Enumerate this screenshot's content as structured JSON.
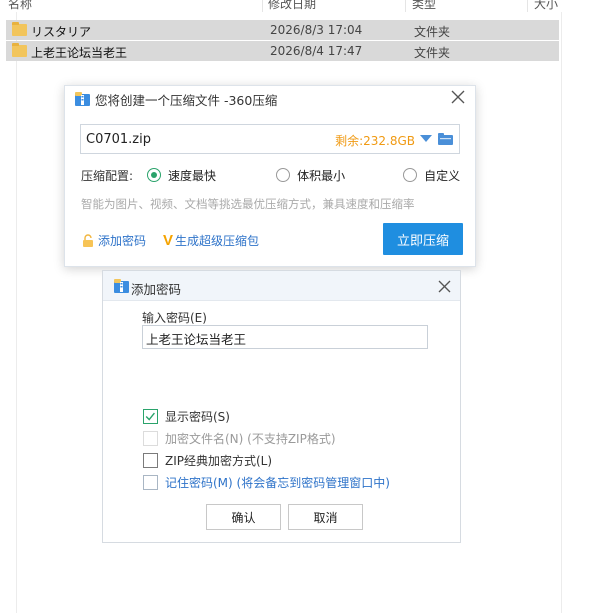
{
  "explorer": {
    "columns": [
      "名称",
      "修改日期",
      "类型",
      "大小"
    ],
    "rows": [
      {
        "name": "リスタリア",
        "date": "2026/8/3 17:04",
        "type": "文件夹"
      },
      {
        "name": "上老王论坛当老王",
        "date": "2026/8/4 17:47",
        "type": "文件夹"
      }
    ]
  },
  "compress_dialog": {
    "title": "您将创建一个压缩文件 -360压缩",
    "filename": "C0701.zip",
    "free_space": "剩余:232.8GB",
    "config_label": "压缩配置:",
    "options": [
      "速度最快",
      "体积最小",
      "自定义"
    ],
    "selected_option": "速度最快",
    "hint": "智能为图片、视频、文档等挑选最优压缩方式，兼具速度和压缩率",
    "add_password": "添加密码",
    "super_package": "生成超级压缩包",
    "compress_button": "立即压缩",
    "colors": {
      "accent": "#1f8ee0",
      "warn": "#f09a13",
      "link": "#2e73c9",
      "radio_on": "#2aa36b"
    }
  },
  "password_dialog": {
    "title": "添加密码",
    "input_label": "输入密码(E)",
    "password_value": "上老王论坛当老王",
    "checkboxes": [
      {
        "label": "显示密码(S)",
        "checked": true,
        "enabled": true
      },
      {
        "label": "加密文件名(N) (不支持ZIP格式)",
        "checked": false,
        "enabled": false
      },
      {
        "label": "ZIP经典加密方式(L)",
        "checked": false,
        "enabled": true
      },
      {
        "label": "记住密码(M) (将会备忘到密码管理窗口中)",
        "checked": false,
        "enabled": true
      }
    ],
    "ok_button": "确认",
    "cancel_button": "取消"
  }
}
